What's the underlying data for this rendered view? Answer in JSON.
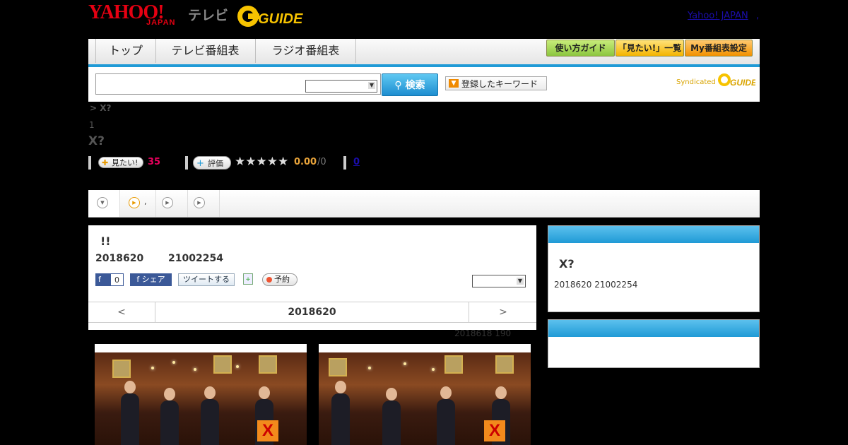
{
  "header": {
    "yahoo_logo": "YAHOO!",
    "japan_logo": "JAPAN",
    "tv_logo": "テレビ",
    "gguide_logo": "G GUIDE",
    "yahoo_japan_link": "Yahoo! JAPAN",
    "dot": ","
  },
  "nav": {
    "tabs": [
      "トップ",
      "テレビ番組表",
      "ラジオ番組表"
    ],
    "right_buttons": [
      "使い方ガイド",
      "「見たい!」一覧",
      "My番組表設定"
    ]
  },
  "search": {
    "input_value": "",
    "select_value": "",
    "search_button": "検索",
    "keyword_button": "登録したキーワード",
    "syndicated": "Syndicated",
    "syndicated_logo": "G GUIDE"
  },
  "program": {
    "breadcrumb": "> X?",
    "episode_no": "1",
    "title": "X?",
    "mitai_label": "見たい!",
    "mitai_count": "35",
    "rating_label": "評価",
    "stars": "★★★★★",
    "score": "0.00",
    "score_denominator": "/0",
    "review_count": "0"
  },
  "media_tabs": [
    "",
    ",",
    "",
    ""
  ],
  "detail": {
    "heading": "!!",
    "date": "2018620",
    "time": "21002254",
    "fb_like": "f",
    "fb_count": "0",
    "fb_share": "f シェア",
    "tweet": "ツイートする",
    "add_icon": "+",
    "reserve": "予約",
    "select_value": "",
    "prev": "<",
    "current_date": "2018620",
    "next": ">",
    "updated": "2018618  190"
  },
  "sidebar": {
    "panel1_title": "X?",
    "panel1_date": "2018620  21002254",
    "panel2_content": ""
  },
  "colors": {
    "accent_blue": "#1f9ad6",
    "yahoo_red": "#e60012",
    "mitai_pink": "#e6005c",
    "score_orange": "#e8a33a"
  }
}
